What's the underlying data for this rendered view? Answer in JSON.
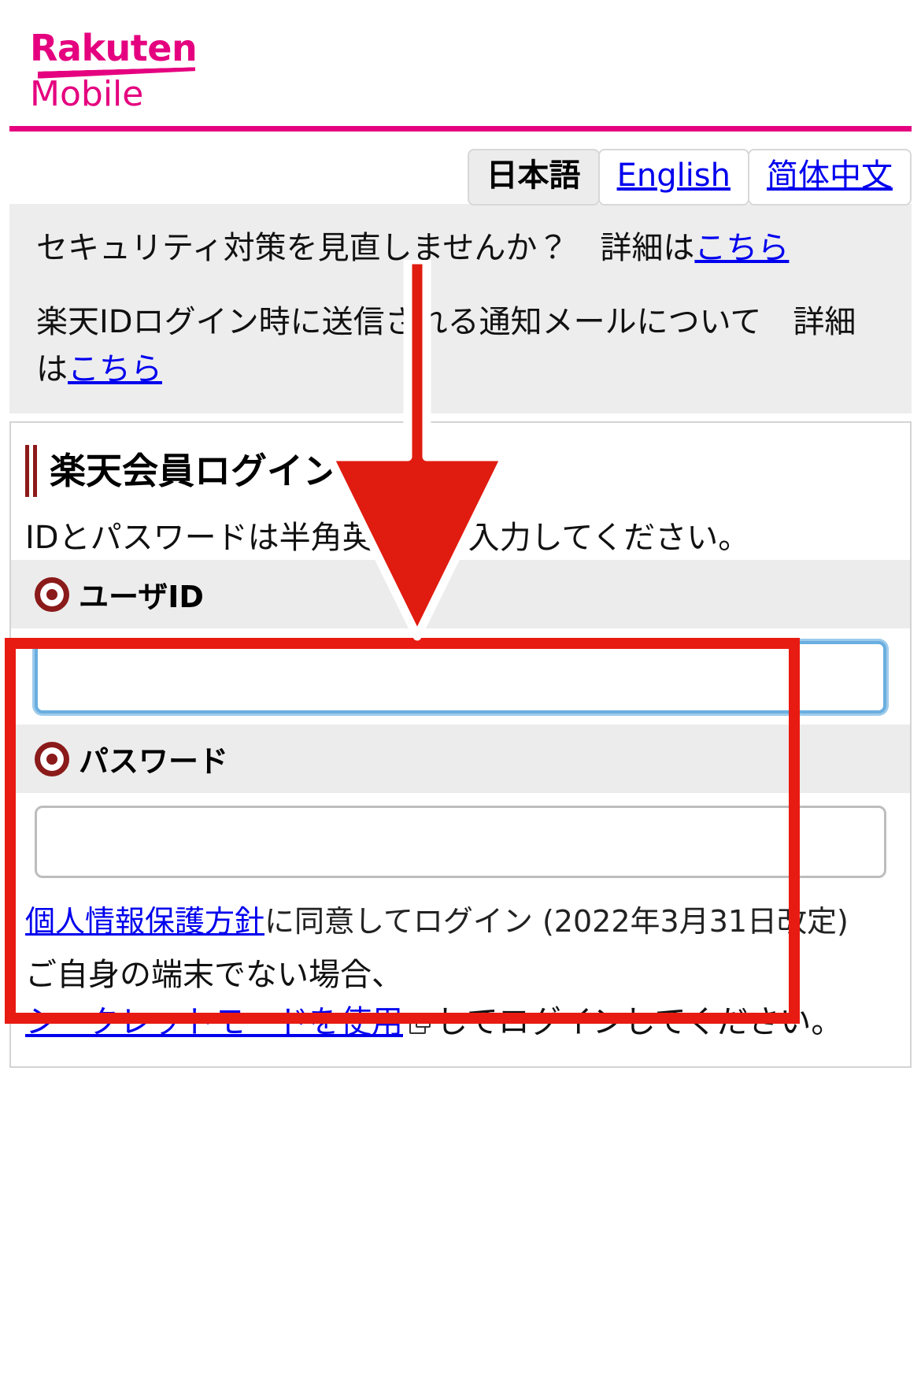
{
  "brand": {
    "logo_primary": "Rakuten",
    "logo_secondary": "Mobile",
    "logo_color": "#e5007f"
  },
  "language_tabs": [
    {
      "label": "日本語",
      "active": true
    },
    {
      "label": "English",
      "active": false
    },
    {
      "label": "简体中文",
      "active": false
    }
  ],
  "notices": [
    {
      "text_before": "セキュリティ対策を見直しませんか？　詳細は",
      "link": "こちら",
      "text_after": ""
    },
    {
      "text_before": "楽天IDログイン時に送信される通知メールについて　詳細は",
      "link": "こちら",
      "text_after": ""
    }
  ],
  "login": {
    "title": "楽天会員ログイン",
    "hint": "IDとパスワードは半角英数字を入力してください。",
    "user_id": {
      "label": "ユーザID",
      "value": "",
      "placeholder": "",
      "required": true,
      "focused": true
    },
    "password": {
      "label": "パスワード",
      "value": "",
      "placeholder": "",
      "required": true,
      "focused": false
    },
    "agree": {
      "link": "個人情報保護方針",
      "text": "に同意してログイン",
      "revision": "(2022年3月31日改定)"
    },
    "secret_mode": {
      "text_before": "ご自身の端末でない場合、",
      "link": "シークレットモードを使用",
      "icon": "external-link-icon",
      "text_after": "してログインしてください。"
    }
  },
  "annotations": {
    "highlight_box_color": "#e81b12",
    "arrow_color": "#e01b0f",
    "arrow_outline": "#ffffff"
  }
}
